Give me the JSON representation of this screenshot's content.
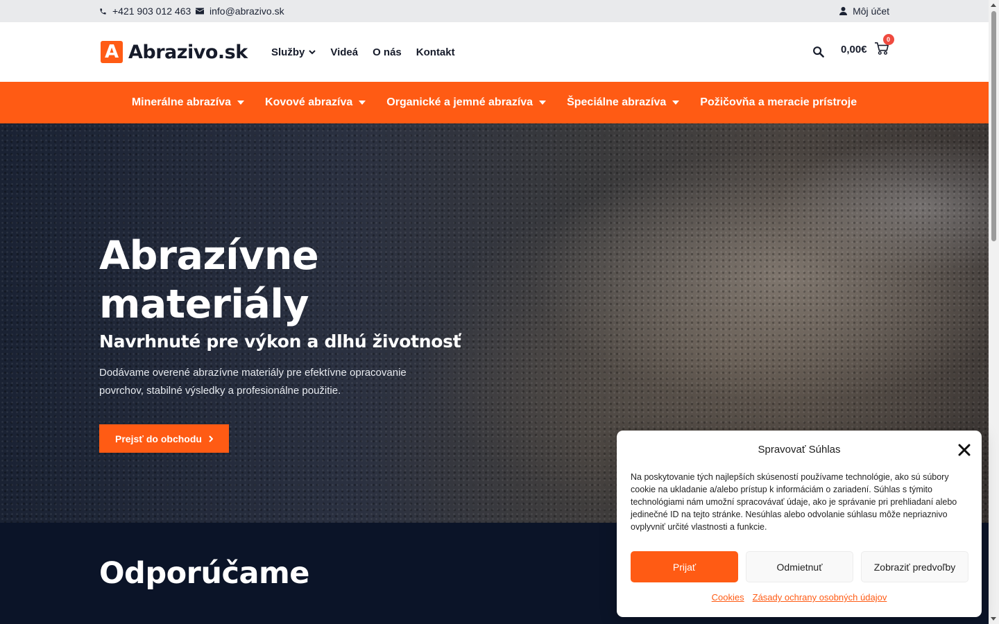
{
  "topbar": {
    "phone": "+421 903 012 463",
    "email": "info@abrazivo.sk",
    "account": "Môj účet"
  },
  "header": {
    "logo_letter": "A",
    "logo_text": "Abrazivo.sk",
    "nav": [
      {
        "label": "Služby",
        "dropdown": true
      },
      {
        "label": "Videá",
        "dropdown": false
      },
      {
        "label": "O nás",
        "dropdown": false
      },
      {
        "label": "Kontakt",
        "dropdown": false
      }
    ],
    "cart_total": "0,00€",
    "cart_count": "0"
  },
  "categories": [
    {
      "label": "Minerálne abrazíva",
      "dropdown": true
    },
    {
      "label": "Kovové abrazíva",
      "dropdown": true
    },
    {
      "label": "Organické a jemné abrazíva",
      "dropdown": true
    },
    {
      "label": "Špeciálne abrazíva",
      "dropdown": true
    },
    {
      "label": "Požičovňa a meracie prístroje",
      "dropdown": false
    }
  ],
  "hero": {
    "title": "Abrazívne materiály",
    "subtitle": "Navrhnuté pre výkon a dlhú životnosť",
    "text": "Dodávame overené abrazívne materiály pre efektívne opracovanie povrchov, stabilné výsledky a profesionálne použitie.",
    "cta": "Prejsť do obchodu"
  },
  "recommend": {
    "title": "Odporúčame"
  },
  "cookie": {
    "title": "Spravovať Súhlas",
    "body": "Na poskytovanie tých najlepších skúseností používame technológie, ako sú súbory cookie na ukladanie a/alebo prístup k informáciám o zariadení. Súhlas s týmito technológiami nám umožní spracovávať údaje, ako je správanie pri prehliadaní alebo jedinečné ID na tejto stránke. Nesúhlas alebo odvolanie súhlasu môže nepriaznivo ovplyvniť určité vlastnosti a funkcie.",
    "accept": "Prijať",
    "deny": "Odmietnuť",
    "prefs": "Zobraziť predvoľby",
    "links": [
      "Cookies",
      "Zásady ochrany osobných údajov"
    ]
  },
  "colors": {
    "accent": "#ff5b14",
    "dark": "#0b1428",
    "badge": "#ef4a3f"
  }
}
